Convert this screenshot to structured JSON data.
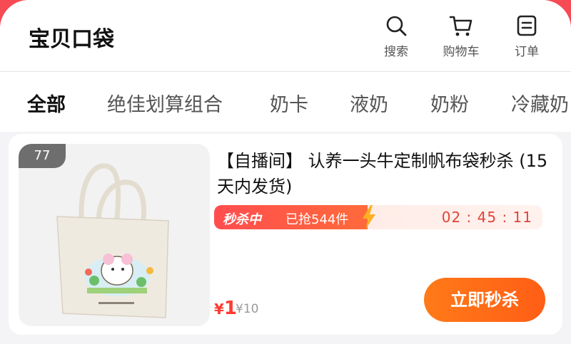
{
  "header": {
    "title": "宝贝口袋",
    "search_label": "搜索",
    "cart_label": "购物车",
    "orders_label": "订单"
  },
  "tabs": [
    "全部",
    "绝佳划算组合",
    "奶卡",
    "液奶",
    "奶粉",
    "冷藏奶"
  ],
  "active_tab": 0,
  "product": {
    "index_badge": "77",
    "title": "【自播间】 认养一头牛定制帆布袋秒杀 (15天内发货)",
    "flash_tag": "秒杀中",
    "sold_text": "已抢544件",
    "countdown": "02 : 45 : 11",
    "price_currency": "¥",
    "price_value": "1",
    "original_price": "¥10",
    "buy_button": "立即秒杀"
  },
  "colors": {
    "accent": "#ff3b30",
    "button_orange": "#ff6a18",
    "background_top": "#f64a55"
  }
}
